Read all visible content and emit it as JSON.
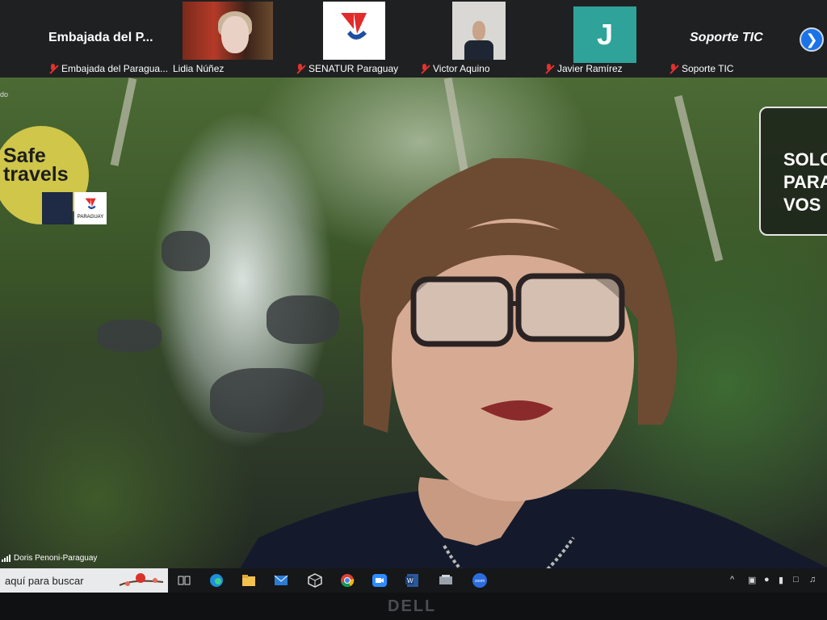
{
  "participants": {
    "tile1": {
      "big_name": "Embajada del P...",
      "label": "Embajada del Paragua..."
    },
    "tile2": {
      "label": "Lidia Núñez"
    },
    "tile3": {
      "label": "SENATUR Paraguay"
    },
    "tile4": {
      "label": "Victor Aquino"
    },
    "tile5": {
      "avatar_letter": "J",
      "label": "Javier Ramírez"
    },
    "tile6": {
      "big_name": "Soporte TIC",
      "label": "Soporte TIC"
    },
    "next_icon": "chevron-right-icon"
  },
  "main_video": {
    "speaker_label": "Doris Penoni-Paraguay",
    "corner_text": "do",
    "safe_travels": "Safe travels",
    "paraguay_logo_text": "PARAGUAY",
    "sign_text": [
      "SOLO",
      "PARA",
      "VOS"
    ]
  },
  "taskbar": {
    "search_placeholder": "aquí para buscar",
    "icons": [
      "task-view-icon",
      "edge-icon",
      "file-explorer-icon",
      "mail-icon",
      "3d-viewer-icon",
      "chrome-icon",
      "zoom-icon",
      "word-icon",
      "settings-icon",
      "meet-icon"
    ]
  },
  "laptop": {
    "brand": "DELL"
  },
  "colors": {
    "strip": "#1f2021",
    "mic_off": "#e0332f",
    "avatar_j": "#2fa39a",
    "safe_badge": "#cfc64a",
    "accent": "#1a73e8"
  }
}
